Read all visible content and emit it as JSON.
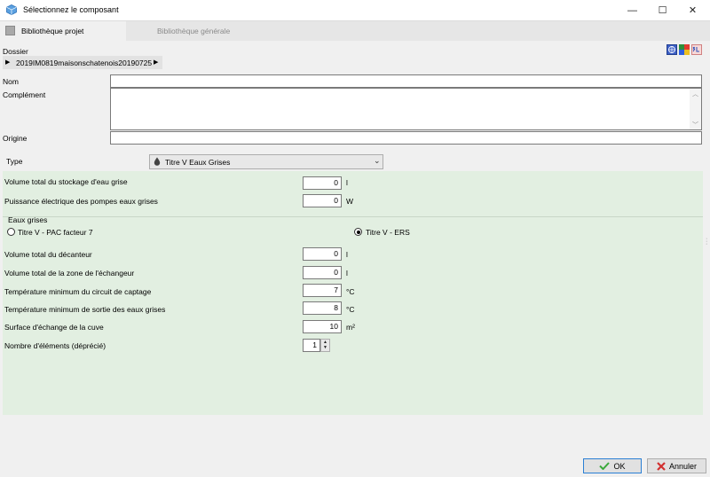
{
  "window": {
    "title": "Sélectionnez le composant",
    "controls": {
      "minimize": "—",
      "maximize": "☐",
      "close": "✕"
    }
  },
  "tabs": [
    {
      "label": "Bibliothèque projet",
      "active": true
    },
    {
      "label": "Bibliothèque générale",
      "active": false
    }
  ],
  "folder": {
    "label": "Dossier",
    "path": "2019IM0819maisonschatenois20190725"
  },
  "fields": {
    "nom": {
      "label": "Nom",
      "value": ""
    },
    "complement": {
      "label": "Complément",
      "value": ""
    },
    "origine": {
      "label": "Origine",
      "value": ""
    }
  },
  "type": {
    "label": "Type",
    "value": "Titre V Eaux Grises"
  },
  "params_top": [
    {
      "label": "Volume total du stockage d'eau grise",
      "value": "0",
      "unit": "l"
    },
    {
      "label": "Puissance électrique des pompes eaux grises",
      "value": "0",
      "unit": "W"
    }
  ],
  "eaux_grises": {
    "label": "Eaux grises",
    "options": [
      {
        "label": "Titre V - PAC facteur 7",
        "selected": false
      },
      {
        "label": "Titre V - ERS",
        "selected": true
      }
    ]
  },
  "params_bottom": [
    {
      "label": "Volume total du décanteur",
      "value": "0",
      "unit": "l"
    },
    {
      "label": "Volume total de la zone de l'échangeur",
      "value": "0",
      "unit": "l"
    },
    {
      "label": "Température minimum du circuit de captage",
      "value": "7",
      "unit": "°C"
    },
    {
      "label": "Température minimum de sortie des eaux grises",
      "value": "8",
      "unit": "°C"
    },
    {
      "label": "Surface d'échange de la cuve",
      "value": "10",
      "unit": "m²"
    }
  ],
  "nombre": {
    "label": "Nombre d'éléments (déprécié)",
    "value": "1"
  },
  "footer": {
    "ok_label": "OK",
    "cancel_label": "Annuler"
  },
  "colors": {
    "panel": "#e2efe1",
    "accent": "#2a7fd4",
    "ok_check": "#3aa83a",
    "cancel_x": "#d23030"
  }
}
